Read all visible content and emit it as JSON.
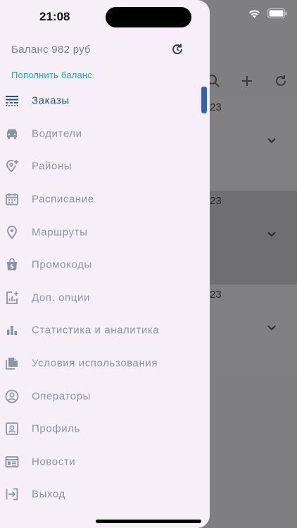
{
  "status": {
    "time": "21:08"
  },
  "drawer": {
    "balance": "Баланс 982 руб",
    "topup_link": "Пополнить баланс",
    "menu": [
      {
        "label": "Заказы",
        "icon": "orders-icon",
        "active": true
      },
      {
        "label": "Водители",
        "icon": "car-icon"
      },
      {
        "label": "Районы",
        "icon": "location-add-icon"
      },
      {
        "label": "Расписание",
        "icon": "calendar-icon"
      },
      {
        "label": "Маршруты",
        "icon": "pin-icon"
      },
      {
        "label": "Промокоды",
        "icon": "promo-bag-icon"
      },
      {
        "label": "Доп. опции",
        "icon": "options-chart-icon"
      },
      {
        "label": "Статистика и аналитика",
        "icon": "bar-chart-icon"
      },
      {
        "label": "Условия использования",
        "icon": "documents-icon"
      },
      {
        "label": "Операторы",
        "icon": "operator-icon"
      },
      {
        "label": "Профиль",
        "icon": "profile-icon"
      },
      {
        "label": "Новости",
        "icon": "news-icon"
      },
      {
        "label": "Выход",
        "icon": "logout-icon"
      }
    ]
  },
  "background": {
    "cards": [
      {
        "date_fragment": "23"
      },
      {
        "date_fragment": "23"
      },
      {
        "date_fragment": "23"
      }
    ]
  },
  "colors": {
    "accent": "#2f62b8",
    "link": "#27a1c4",
    "drawer_bg": "#f6eff7"
  }
}
